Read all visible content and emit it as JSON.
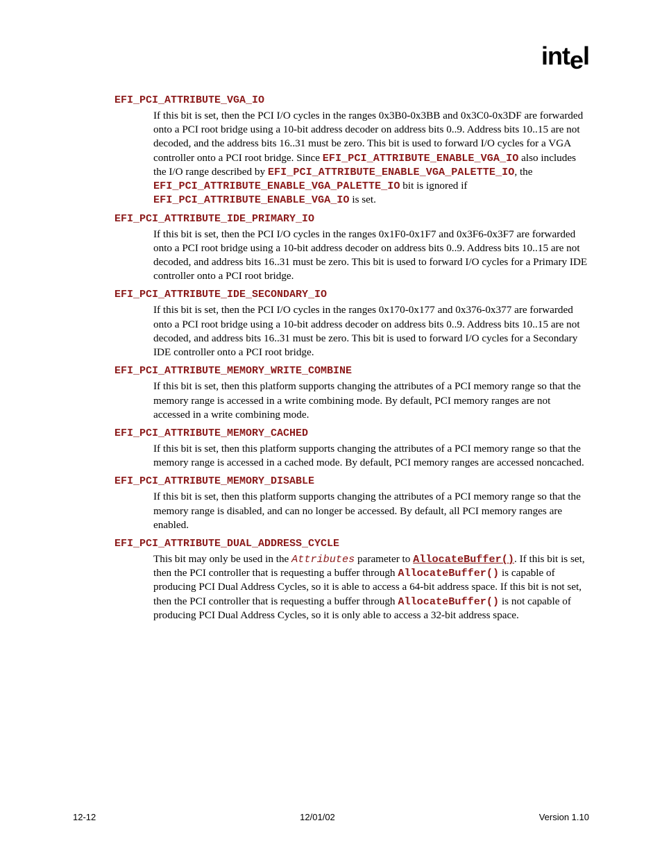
{
  "logo": "intel",
  "sections": [
    {
      "term": "EFI_PCI_ATTRIBUTE_VGA_IO",
      "runs": [
        {
          "t": "plain",
          "v": "If this bit is set, then the PCI I/O cycles in the ranges 0x3B0-0x3BB and 0x3C0-0x3DF are forwarded onto a PCI root bridge using a 10-bit address decoder on address bits 0..9.  Address bits 10..15 are not decoded, and the address bits 16..31 must be zero.  This bit is used to forward I/O cycles for a VGA controller onto a PCI root bridge.  Since "
        },
        {
          "t": "mono",
          "v": "EFI_PCI_ATTRIBUTE_ENABLE_VGA_IO"
        },
        {
          "t": "plain",
          "v": " also includes the I/O range described by "
        },
        {
          "t": "mono",
          "v": "EFI_PCI_ATTRIBUTE_ENABLE_VGA_PALETTE_IO"
        },
        {
          "t": "plain",
          "v": ", the "
        },
        {
          "t": "mono",
          "v": "EFI_PCI_ATTRIBUTE_ENABLE_VGA_PALETTE_IO"
        },
        {
          "t": "plain",
          "v": " bit is ignored if "
        },
        {
          "t": "mono",
          "v": "EFI_PCI_ATTRIBUTE_ENABLE_VGA_IO"
        },
        {
          "t": "plain",
          "v": " is set."
        }
      ]
    },
    {
      "term": "EFI_PCI_ATTRIBUTE_IDE_PRIMARY_IO",
      "runs": [
        {
          "t": "plain",
          "v": "If this bit is set, then the PCI I/O cycles in the ranges 0x1F0-0x1F7 and 0x3F6-0x3F7 are forwarded onto a PCI root bridge using a 10-bit address decoder on address bits 0..9.  Address bits 10..15 are not decoded, and address bits 16..31 must be zero.  This bit is used to forward I/O cycles for a Primary IDE controller onto a PCI root bridge."
        }
      ]
    },
    {
      "term": "EFI_PCI_ATTRIBUTE_IDE_SECONDARY_IO",
      "runs": [
        {
          "t": "plain",
          "v": "If this bit is set, then the PCI I/O cycles in the ranges 0x170-0x177 and 0x376-0x377 are forwarded onto a PCI root bridge using a 10-bit address decoder on address bits 0..9.  Address bits 10..15 are not decoded, and address bits 16..31 must be zero.  This bit is used to forward I/O cycles for a Secondary IDE controller onto a PCI root bridge."
        }
      ]
    },
    {
      "term": "EFI_PCI_ATTRIBUTE_MEMORY_WRITE_COMBINE",
      "runs": [
        {
          "t": "plain",
          "v": "If this bit is set, then this platform supports changing the attributes of a PCI memory range so that the memory range is accessed in a write combining mode.  By default, PCI memory ranges are not accessed in a write combining mode."
        }
      ]
    },
    {
      "term": "EFI_PCI_ATTRIBUTE_MEMORY_CACHED",
      "runs": [
        {
          "t": "plain",
          "v": "If this bit is set, then this platform supports changing the attributes of a PCI memory range so that the memory range is accessed in a cached mode.  By default, PCI memory ranges are accessed noncached."
        }
      ]
    },
    {
      "term": "EFI_PCI_ATTRIBUTE_MEMORY_DISABLE",
      "runs": [
        {
          "t": "plain",
          "v": "If this bit is set, then this platform supports changing the attributes of a PCI memory range so that the memory range is disabled, and can no longer be accessed.  By default, all PCI memory ranges are enabled."
        }
      ]
    },
    {
      "term": "EFI_PCI_ATTRIBUTE_DUAL_ADDRESS_CYCLE",
      "runs": [
        {
          "t": "plain",
          "v": "This bit may only be used in the "
        },
        {
          "t": "italic",
          "v": "Attributes"
        },
        {
          "t": "plain",
          "v": " parameter to "
        },
        {
          "t": "link",
          "v": "AllocateBuffer()"
        },
        {
          "t": "plain",
          "v": ".  If this bit is set, then the PCI controller that is requesting a buffer through "
        },
        {
          "t": "mono",
          "v": "AllocateBuffer()"
        },
        {
          "t": "plain",
          "v": " is capable of producing PCI Dual Address Cycles, so it is able to access a 64-bit address space.  If this bit is not set, then the PCI controller that is requesting a buffer through "
        },
        {
          "t": "mono",
          "v": "AllocateBuffer()"
        },
        {
          "t": "plain",
          "v": " is not capable of producing PCI Dual Address Cycles, so it is only able to access a 32-bit address space."
        }
      ]
    }
  ],
  "footer": {
    "left": "12-12",
    "center": "12/01/02",
    "right": "Version 1.10"
  }
}
